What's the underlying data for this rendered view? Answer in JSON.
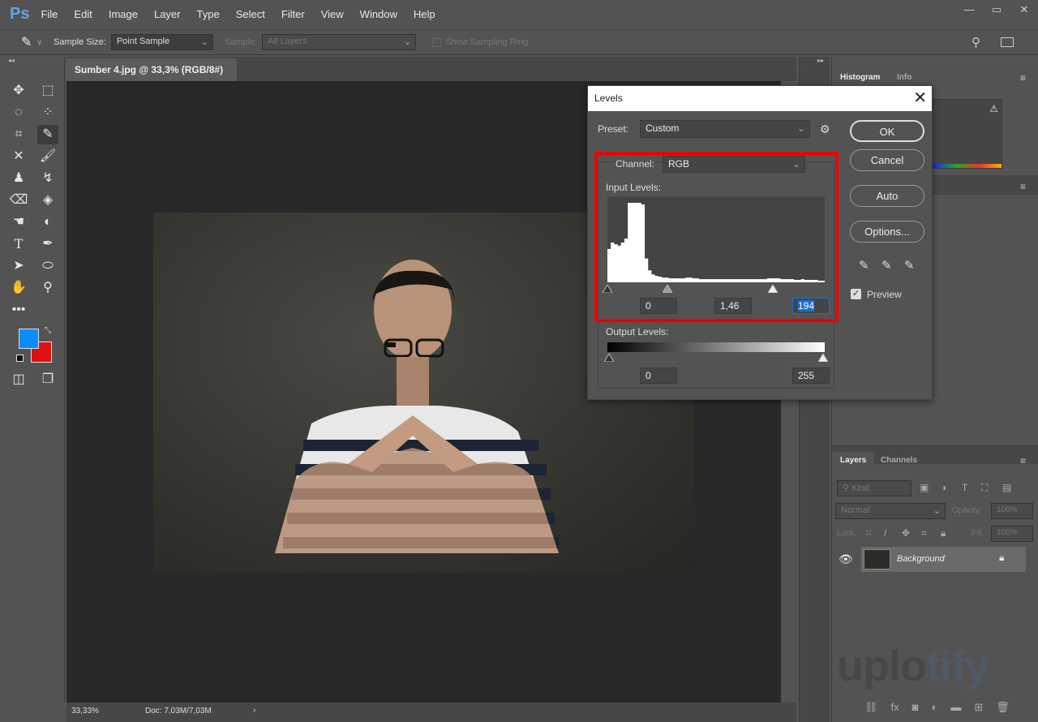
{
  "app": {
    "logo": "Ps",
    "menu": [
      "File",
      "Edit",
      "Image",
      "Layer",
      "Type",
      "Select",
      "Filter",
      "View",
      "Window",
      "Help"
    ],
    "window_controls": [
      "minimize",
      "maximize",
      "close"
    ]
  },
  "options": {
    "sample_size_label": "Sample Size:",
    "sample_size_value": "Point Sample",
    "sample_label": "Sample:",
    "sample_value": "All Layers",
    "sampling_ring_label": "Show Sampling Ring"
  },
  "document": {
    "tab_title": "Sumber 4.jpg @ 33,3% (RGB/8#)",
    "close": "×",
    "zoom": "33,33%",
    "doc_size": "Doc: 7,03M/7,03M"
  },
  "colors": {
    "foreground": "#0a8cff",
    "background": "#dd1111",
    "highlight": "#ee0000",
    "accent": "#1a6fd0"
  },
  "panels": {
    "top_tabs": [
      "Histogram",
      "Info"
    ],
    "layers_tabs": [
      "Layers",
      "Channels"
    ],
    "kind_placeholder": "Kind",
    "blend_mode": "Normal",
    "opacity_label": "Opacity:",
    "opacity_value": "100%",
    "lock_label": "Lock:",
    "fill_label": "Fill:",
    "fill_value": "100%",
    "layer_name": "Background"
  },
  "levels": {
    "title": "Levels",
    "preset_label": "Preset:",
    "preset_value": "Custom",
    "channel_label": "Channel:",
    "channel_value": "RGB",
    "input_label": "Input Levels:",
    "input_black": "0",
    "input_gamma": "1,46",
    "input_white": "194",
    "output_label": "Output Levels:",
    "output_black": "0",
    "output_white": "255",
    "buttons": {
      "ok": "OK",
      "cancel": "Cancel",
      "auto": "Auto",
      "options": "Options..."
    },
    "preview_label": "Preview",
    "preview_checked": true,
    "slider_values": {
      "black": 0,
      "gamma": 1.46,
      "white": 194
    },
    "histogram_profile": [
      0.42,
      0.5,
      0.48,
      0.46,
      0.5,
      0.55,
      1,
      1,
      1,
      1,
      0.98,
      0.3,
      0.15,
      0.1,
      0.08,
      0.07,
      0.06,
      0.06,
      0.05,
      0.05,
      0.05,
      0.05,
      0.05,
      0.06,
      0.06,
      0.05,
      0.05,
      0.04,
      0.04,
      0.04,
      0.04,
      0.04,
      0.04,
      0.04,
      0.04,
      0.04,
      0.04,
      0.04,
      0.04,
      0.04,
      0.04,
      0.04,
      0.04,
      0.04,
      0.04,
      0.04,
      0.04,
      0.05,
      0.05,
      0.05,
      0.05,
      0.04,
      0.04,
      0.04,
      0.04,
      0.03,
      0.03,
      0.04,
      0.03,
      0.03,
      0.03,
      0.03,
      0.02,
      0.02
    ]
  },
  "watermark": {
    "text1": "uplo",
    "text2": "tify"
  }
}
